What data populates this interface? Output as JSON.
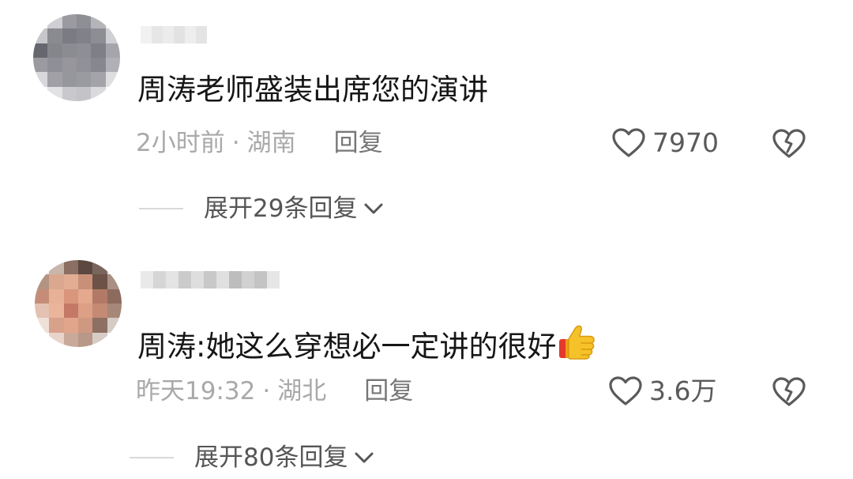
{
  "comments": [
    {
      "text": "周涛老师盛装出席您的演讲",
      "time": "2小时前",
      "separator": "·",
      "location": "湖南",
      "reply_label": "回复",
      "likes": "7970",
      "expand_label": "展开29条回复"
    },
    {
      "text": "周涛:她这么穿想必一定讲的很好",
      "time": "昨天19:32",
      "separator": "·",
      "location": "湖北",
      "reply_label": "回复",
      "likes": "3.6万",
      "expand_label": "展开80条回复"
    }
  ],
  "colors": {
    "text": "#161616",
    "meta": "#a9a9a9",
    "reply": "#777777",
    "icon": "#5a5a5a",
    "divider": "#d9d9d9"
  },
  "icons": [
    "heart-outline-icon",
    "broken-heart-icon",
    "chevron-down-icon",
    "thumbs-up-emoji"
  ]
}
